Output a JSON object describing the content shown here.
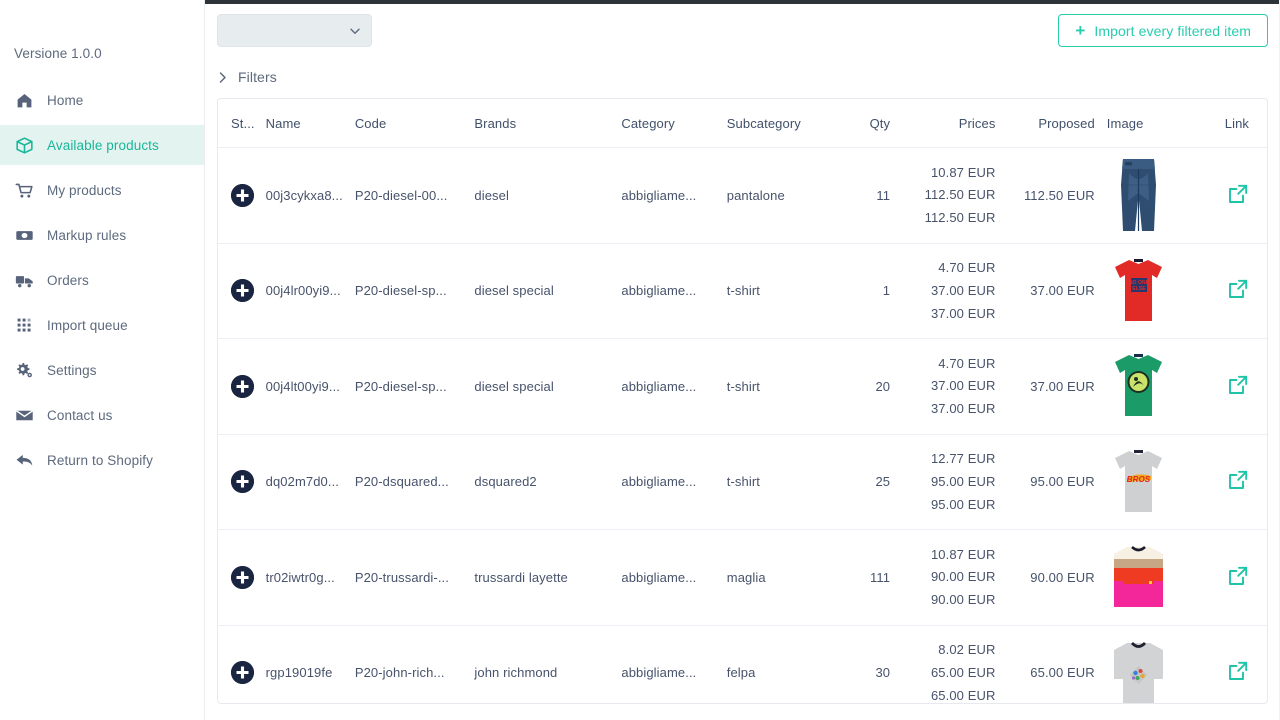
{
  "sidebar": {
    "version": "Versione 1.0.0",
    "items": [
      {
        "label": "Home",
        "icon": "home-icon",
        "active": false
      },
      {
        "label": "Available products",
        "icon": "box-icon",
        "active": true
      },
      {
        "label": "My products",
        "icon": "cart-icon",
        "active": false
      },
      {
        "label": "Markup rules",
        "icon": "money-icon",
        "active": false
      },
      {
        "label": "Orders",
        "icon": "truck-icon",
        "active": false
      },
      {
        "label": "Import queue",
        "icon": "grid-icon",
        "active": false
      },
      {
        "label": "Settings",
        "icon": "gear-icon",
        "active": false
      },
      {
        "label": "Contact us",
        "icon": "envelope-icon",
        "active": false
      },
      {
        "label": "Return to Shopify",
        "icon": "back-arrow-icon",
        "active": false
      }
    ]
  },
  "toolbar": {
    "select_value": "",
    "select_placeholder": "",
    "select_icon": "chevron-down-icon",
    "import_button_label": "Import every filtered item",
    "import_button_icon": "plus-icon",
    "filters_label": "Filters",
    "filters_icon": "chevron-right-icon"
  },
  "table": {
    "columns": [
      "St...",
      "Name",
      "Code",
      "Brands",
      "Category",
      "Subcategory",
      "Qty",
      "Prices",
      "Proposed",
      "Image",
      "Link"
    ],
    "rows": [
      {
        "add_icon": "plus-circle-icon",
        "name": "00j3cykxa8...",
        "code": "P20-diesel-00...",
        "brand": "diesel",
        "category": "abbigliame...",
        "subcategory": "pantalone",
        "qty": "11",
        "prices": [
          "10.87 EUR",
          "112.50 EUR",
          "112.50 EUR"
        ],
        "proposed": "112.50 EUR",
        "image": "jeans-thumbnail",
        "link_icon": "external-link-icon"
      },
      {
        "add_icon": "plus-circle-icon",
        "name": "00j4lr00yi9...",
        "code": "P20-diesel-sp...",
        "brand": "diesel special",
        "category": "abbigliame...",
        "subcategory": "t-shirt",
        "qty": "1",
        "prices": [
          "4.70 EUR",
          "37.00 EUR",
          "37.00 EUR"
        ],
        "proposed": "37.00 EUR",
        "image": "red-tshirt-thumbnail",
        "link_icon": "external-link-icon"
      },
      {
        "add_icon": "plus-circle-icon",
        "name": "00j4lt00yi9...",
        "code": "P20-diesel-sp...",
        "brand": "diesel special",
        "category": "abbigliame...",
        "subcategory": "t-shirt",
        "qty": "20",
        "prices": [
          "4.70 EUR",
          "37.00 EUR",
          "37.00 EUR"
        ],
        "proposed": "37.00 EUR",
        "image": "green-tshirt-thumbnail",
        "link_icon": "external-link-icon"
      },
      {
        "add_icon": "plus-circle-icon",
        "name": "dq02m7d0...",
        "code": "P20-dsquared...",
        "brand": "dsquared2",
        "category": "abbigliame...",
        "subcategory": "t-shirt",
        "qty": "25",
        "prices": [
          "12.77 EUR",
          "95.00 EUR",
          "95.00 EUR"
        ],
        "proposed": "95.00 EUR",
        "image": "grey-bros-tshirt-thumbnail",
        "link_icon": "external-link-icon"
      },
      {
        "add_icon": "plus-circle-icon",
        "name": "tr02iwtr0g...",
        "code": "P20-trussardi-...",
        "brand": "trussardi layette",
        "category": "abbigliame...",
        "subcategory": "maglia",
        "qty": "111",
        "prices": [
          "10.87 EUR",
          "90.00 EUR",
          "90.00 EUR"
        ],
        "proposed": "90.00 EUR",
        "image": "striped-sweater-thumbnail",
        "link_icon": "external-link-icon"
      },
      {
        "add_icon": "plus-circle-icon",
        "name": "rgp19019fe",
        "code": "P20-john-rich...",
        "brand": "john richmond",
        "category": "abbigliame...",
        "subcategory": "felpa",
        "qty": "30",
        "prices": [
          "8.02 EUR",
          "65.00 EUR",
          "65.00 EUR"
        ],
        "proposed": "65.00 EUR",
        "image": "grey-sweatshirt-thumbnail",
        "link_icon": "external-link-icon"
      }
    ]
  },
  "colors": {
    "accent_teal": "#28cdae",
    "active_nav_text": "#19b79a",
    "active_nav_bg": "#e3f3ef",
    "text_muted": "#5d6a7e",
    "topbar": "#2e3338"
  }
}
